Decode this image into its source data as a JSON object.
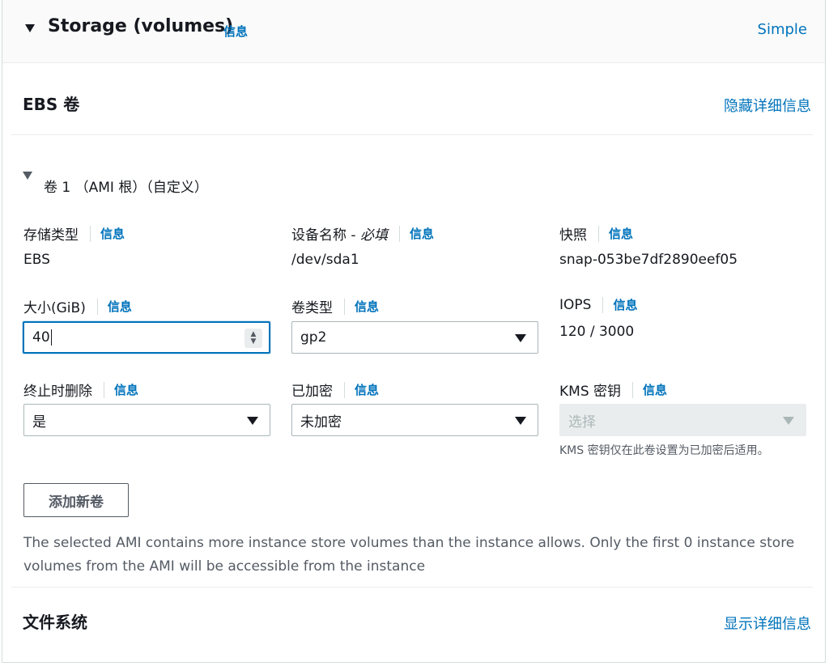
{
  "header": {
    "title": "Storage (volumes)",
    "info": "信息",
    "mode_link": "Simple"
  },
  "ebs": {
    "title": "EBS 卷",
    "toggle_link": "隐藏详细信息"
  },
  "volume": {
    "title": "卷 1 （AMI 根）（自定义）",
    "storage_type": {
      "label": "存储类型",
      "info": "信息",
      "value": "EBS"
    },
    "device_name": {
      "label": "设备名称 - ",
      "label_required": "必填",
      "info": "信息",
      "value": "/dev/sda1"
    },
    "snapshot": {
      "label": "快照",
      "info": "信息",
      "value": "snap-053be7df2890eef05"
    },
    "size": {
      "label": "大小(GiB)",
      "info": "信息",
      "value": "40"
    },
    "volume_type": {
      "label": "卷类型",
      "info": "信息",
      "value": "gp2"
    },
    "iops": {
      "label": "IOPS",
      "info": "信息",
      "value": "120 / 3000"
    },
    "delete_on_termination": {
      "label": "终止时删除",
      "info": "信息",
      "value": "是"
    },
    "encrypted": {
      "label": "已加密",
      "info": "信息",
      "value": "未加密"
    },
    "kms_key": {
      "label": "KMS 密钥",
      "info": "信息",
      "placeholder": "选择",
      "note": "KMS 密钥仅在此卷设置为已加密后适用。"
    }
  },
  "add_volume_button": "添加新卷",
  "warning": "The selected AMI contains more instance store volumes than the instance allows. Only the first 0 instance store volumes from the AMI will be accessible from the instance",
  "filesystem": {
    "title": "文件系统",
    "toggle_link": "显示详细信息"
  },
  "colors": {
    "link": "#0073bb",
    "focus": "#0073bb",
    "text": "#16191f"
  }
}
